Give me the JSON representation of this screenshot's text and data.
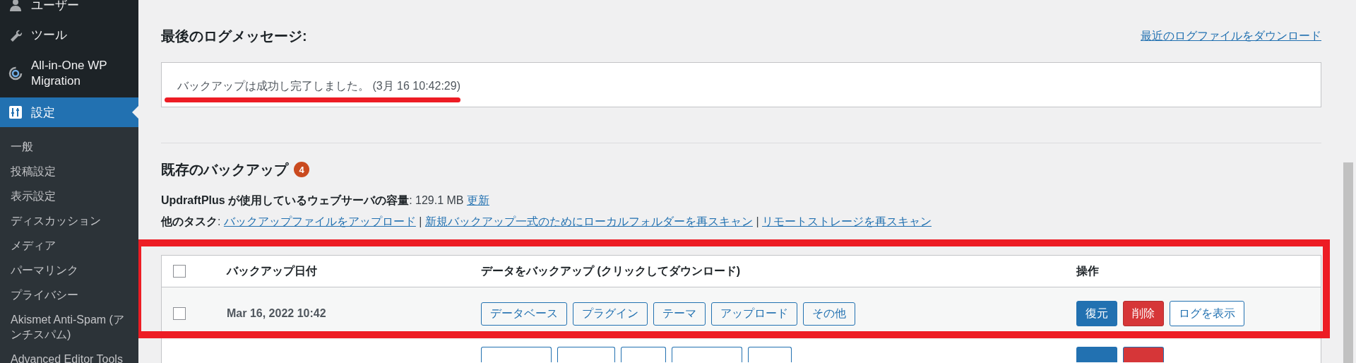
{
  "sidebar": {
    "items": [
      {
        "label": "ユーザー",
        "selected": false
      },
      {
        "label": "ツール",
        "selected": false
      },
      {
        "label": "All-in-One WP Migration",
        "selected": false
      },
      {
        "label": "設定",
        "selected": true,
        "children": [
          {
            "label": "一般",
            "selected": false
          },
          {
            "label": "投稿設定",
            "selected": false
          },
          {
            "label": "表示設定",
            "selected": false
          },
          {
            "label": "ディスカッション",
            "selected": false
          },
          {
            "label": "メディア",
            "selected": false
          },
          {
            "label": "パーマリンク",
            "selected": false
          },
          {
            "label": "プライバシー",
            "selected": false
          },
          {
            "label": "Akismet Anti-Spam (アンチスパム)",
            "selected": false
          },
          {
            "label": "Advanced Editor Tools",
            "selected": false
          }
        ]
      }
    ]
  },
  "log": {
    "title": "最後のログメッセージ:",
    "download_link": "最近のログファイルをダウンロード",
    "message": "バックアップは成功し完了しました。 (3月 16 10:42:29)",
    "underlined": true
  },
  "backups": {
    "title": "既存のバックアップ",
    "count": "4",
    "usage": {
      "label": "UpdraftPlus が使用しているウェブサーバの容量",
      "value": ": 129.1 MB",
      "link": "更新"
    },
    "tasks": {
      "label": "**他のタスク**:",
      "separators": [
        "|",
        "|"
      ],
      "links": [
        "バックアップファイルをアップロード",
        "新規バックアップ一式のためにローカルフォルダーを再スキャン",
        "リモートストレージを再スキャン"
      ]
    },
    "table": {
      "framed": true,
      "header_checked": false,
      "columns": [
        {
          "label": "バックアップ日付"
        },
        {
          "label": "データをバックアップ (クリックしてダウンロード)"
        },
        {
          "label": "操作"
        }
      ],
      "rows": [
        {
          "checked": false,
          "date": "Mar 16, 2022 10:42",
          "files": [
            "データベース",
            "プラグイン",
            "テーマ",
            "アップロード",
            "その他"
          ],
          "actions": [
            {
              "label": "復元",
              "kind": "primary"
            },
            {
              "label": "削除",
              "kind": "danger"
            },
            {
              "label": "ログを表示",
              "kind": "secondary"
            }
          ]
        }
      ]
    }
  }
}
